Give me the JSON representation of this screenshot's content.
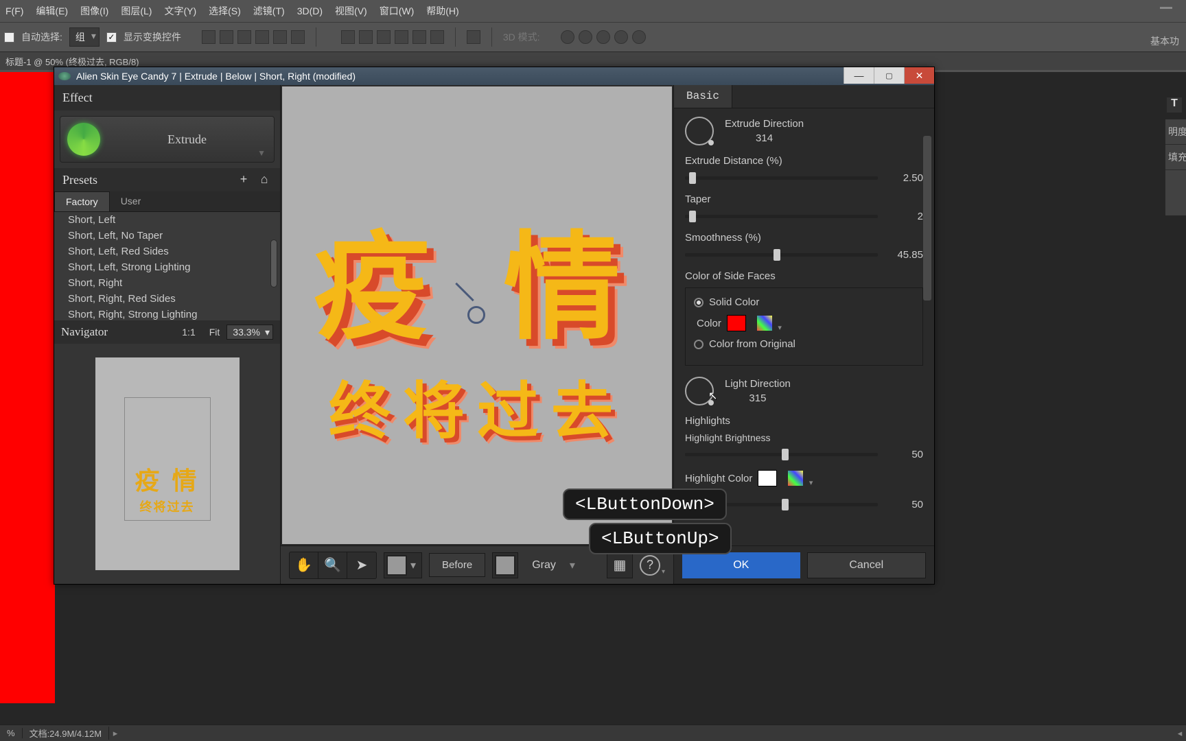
{
  "menubar": [
    "F(F)",
    "编辑(E)",
    "图像(I)",
    "图层(L)",
    "文字(Y)",
    "选择(S)",
    "滤镜(T)",
    "3D(D)",
    "视图(V)",
    "窗口(W)",
    "帮助(H)"
  ],
  "optionbar": {
    "auto_select": "自动选择:",
    "group": "组",
    "show_transform": "显示变换控件",
    "mode3d_label": "3D 模式:"
  },
  "right_label": "基本功",
  "doctab": "标题-1 @ 50% (终极过去, RGB/8)",
  "dialog": {
    "title": "Alien Skin Eye Candy 7 | Extrude | Below | Short, Right (modified)",
    "effect_header": "Effect",
    "effect_name": "Extrude",
    "presets_header": "Presets",
    "tabs": {
      "factory": "Factory",
      "user": "User"
    },
    "presets": [
      "Short, Left",
      "Short, Left, No Taper",
      "Short, Left, Red Sides",
      "Short, Left, Strong Lighting",
      "Short, Right",
      "Short, Right, Red Sides",
      "Short, Right, Strong Lighting"
    ],
    "navigator": {
      "header": "Navigator",
      "one_to_one": "1:1",
      "fit": "Fit",
      "zoom": "33.3%"
    },
    "nav_text1": "疫 情",
    "nav_text2": "终将过去",
    "preview_text1": "疫 情",
    "preview_text2": "终将过去",
    "toolbar": {
      "before": "Before",
      "bg": "Gray"
    },
    "settings_tab": "Basic",
    "settings": {
      "extrude_direction_label": "Extrude Direction",
      "extrude_direction": "314",
      "extrude_distance_label": "Extrude Distance (%)",
      "extrude_distance": "2.50",
      "taper_label": "Taper",
      "taper": "2",
      "smoothness_label": "Smoothness (%)",
      "smoothness": "45.85",
      "color_side_label": "Color of Side Faces",
      "solid_color": "Solid Color",
      "color_label": "Color",
      "color_from_original": "Color from Original",
      "light_direction_label": "Light Direction",
      "light_direction": "315",
      "highlights_label": "Highlights",
      "highlight_brightness_label": "Highlight Brightness",
      "highlight_brightness": "50",
      "highlight_color_label": "Highlight Color",
      "highlight_size": "50"
    },
    "buttons": {
      "ok": "OK",
      "cancel": "Cancel"
    }
  },
  "events": {
    "down": "<LButtonDown>",
    "up": "<LButtonUp>"
  },
  "statusbar": {
    "pct": "%",
    "doc": "文档:24.9M/4.12M"
  },
  "ps_right": {
    "brightness": "明度",
    "fill": "填充"
  }
}
